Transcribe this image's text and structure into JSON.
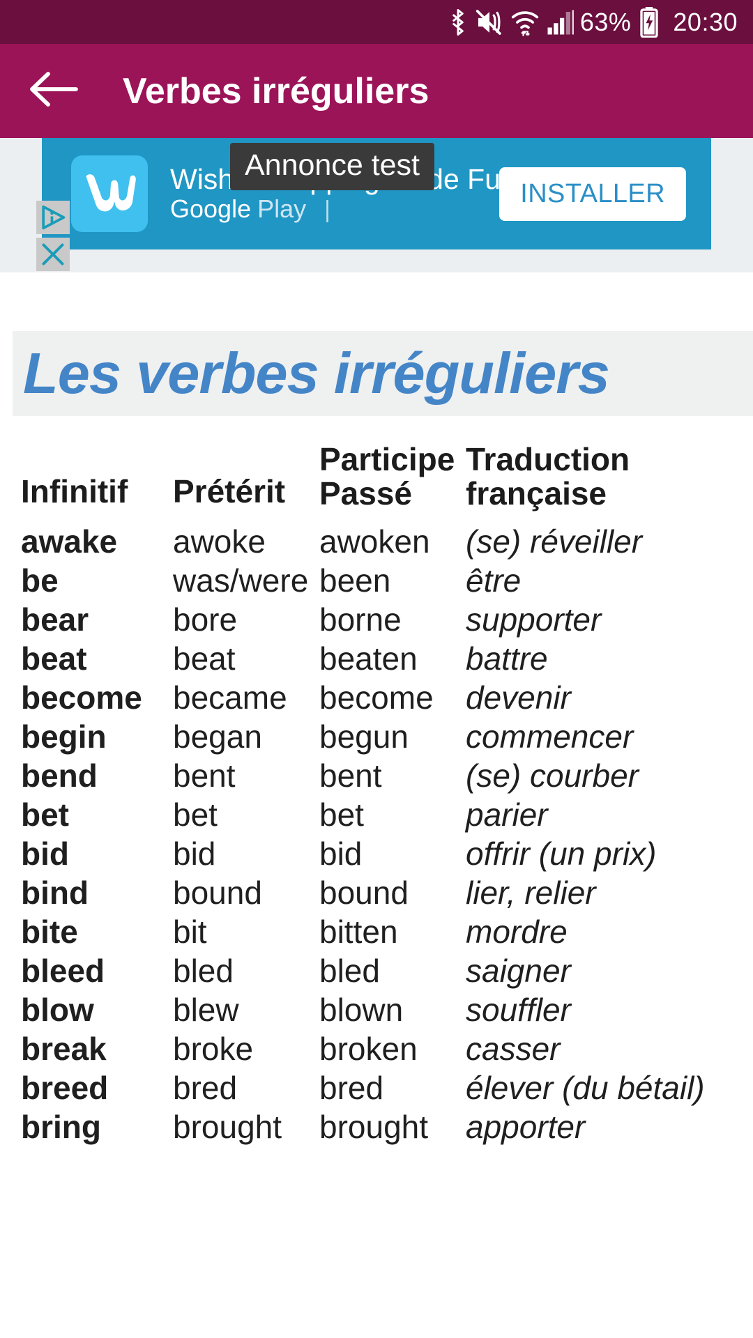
{
  "statusbar": {
    "battery_percent": "63%",
    "time": "20:30",
    "icons": [
      "bluetooth-icon",
      "vibrate-mute-icon",
      "wifi-icon",
      "signal-bars-icon",
      "battery-charging-icon"
    ]
  },
  "appbar": {
    "back_label": "back-arrow",
    "title": "Verbes irréguliers"
  },
  "ad": {
    "overlay_label": "Annonce test",
    "app_title": "Wish - Shopping Made Fun",
    "store_g": "Google",
    "store_play": "Play",
    "separator": "|",
    "install_label": "INSTALLER",
    "app_icon_letter": "w",
    "info_icon": "ad-info-icon",
    "close_icon": "ad-close-icon"
  },
  "document": {
    "title": "Les verbes irréguliers",
    "table": {
      "headers": [
        "Infinitif",
        "Prétérit",
        "Participe Passé",
        "Traduction française"
      ],
      "headers_split": [
        [
          "Infinitif",
          ""
        ],
        [
          "Prétérit",
          ""
        ],
        [
          "Participe",
          "Passé"
        ],
        [
          "Traduction",
          "française"
        ]
      ],
      "rows": [
        {
          "infinitif": "awake",
          "preterit": "awoke",
          "participe": "awoken",
          "traduction": "(se) réveiller"
        },
        {
          "infinitif": "be",
          "preterit": "was/were",
          "participe": "been",
          "traduction": "être"
        },
        {
          "infinitif": "bear",
          "preterit": "bore",
          "participe": "borne",
          "traduction": "supporter"
        },
        {
          "infinitif": "beat",
          "preterit": "beat",
          "participe": "beaten",
          "traduction": "battre"
        },
        {
          "infinitif": "become",
          "preterit": "became",
          "participe": "become",
          "traduction": "devenir"
        },
        {
          "infinitif": "begin",
          "preterit": "began",
          "participe": "begun",
          "traduction": "commencer"
        },
        {
          "infinitif": "bend",
          "preterit": "bent",
          "participe": "bent",
          "traduction": "(se) courber"
        },
        {
          "infinitif": "bet",
          "preterit": "bet",
          "participe": "bet",
          "traduction": "parier"
        },
        {
          "infinitif": "bid",
          "preterit": "bid",
          "participe": "bid",
          "traduction": "offrir (un prix)"
        },
        {
          "infinitif": "bind",
          "preterit": "bound",
          "participe": "bound",
          "traduction": "lier, relier"
        },
        {
          "infinitif": "bite",
          "preterit": "bit",
          "participe": "bitten",
          "traduction": "mordre"
        },
        {
          "infinitif": "bleed",
          "preterit": "bled",
          "participe": "bled",
          "traduction": "saigner"
        },
        {
          "infinitif": "blow",
          "preterit": "blew",
          "participe": "blown",
          "traduction": "souffler"
        },
        {
          "infinitif": "break",
          "preterit": "broke",
          "participe": "broken",
          "traduction": "casser"
        },
        {
          "infinitif": "breed",
          "preterit": "bred",
          "participe": "bred",
          "traduction": "élever (du bétail)"
        },
        {
          "infinitif": "bring",
          "preterit": "brought",
          "participe": "brought",
          "traduction": "apporter"
        }
      ]
    }
  },
  "colors": {
    "statusbar_bg": "#6a0f3e",
    "appbar_bg": "#9c1458",
    "ad_bg": "#2096c4",
    "title_blue": "#4485c7",
    "title_band_bg": "#eff0f0"
  }
}
